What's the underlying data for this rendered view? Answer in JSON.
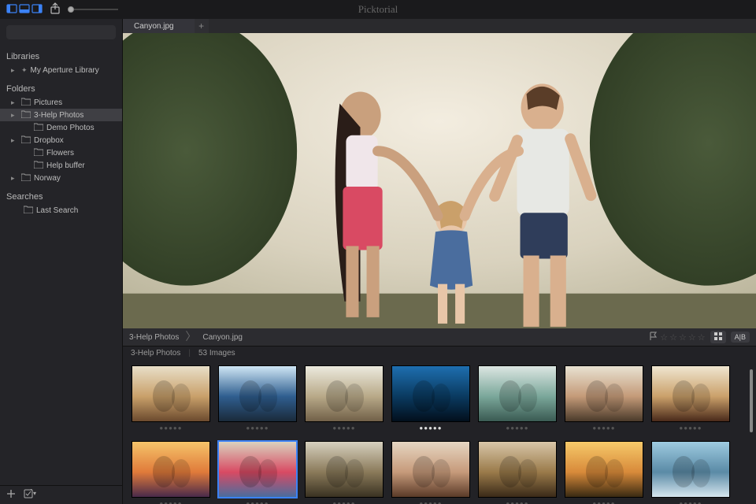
{
  "app_title": "Picktorial",
  "toolbar": {
    "view_icons": [
      "view-layout-left-icon",
      "view-layout-split-icon",
      "view-layout-right-icon"
    ],
    "share_icon": "share-icon"
  },
  "sidebar": {
    "search_placeholder": "",
    "sections": {
      "libraries": {
        "title": "Libraries",
        "items": [
          {
            "label": "My Aperture Library",
            "expandable": true
          }
        ]
      },
      "folders": {
        "title": "Folders",
        "items": [
          {
            "label": "Pictures",
            "expandable": true,
            "indent": 1
          },
          {
            "label": "3-Help Photos",
            "expandable": true,
            "indent": 1,
            "selected": true
          },
          {
            "label": "Demo Photos",
            "expandable": false,
            "indent": 2
          },
          {
            "label": "Dropbox",
            "expandable": true,
            "indent": 1
          },
          {
            "label": "Flowers",
            "expandable": false,
            "indent": 2
          },
          {
            "label": "Help buffer",
            "expandable": false,
            "indent": 2
          },
          {
            "label": "Norway",
            "expandable": true,
            "indent": 1
          }
        ]
      },
      "searches": {
        "title": "Searches",
        "items": [
          {
            "label": "Last Search",
            "expandable": false,
            "indent": 2
          }
        ]
      }
    },
    "footer": {
      "add": "plus-icon",
      "edit": "edit-checkbox-icon"
    }
  },
  "tabs": [
    {
      "label": "Canyon.jpg"
    }
  ],
  "breadcrumb": {
    "folder": "3-Help Photos",
    "file": "Canyon.jpg"
  },
  "info_bar": {
    "flag": "flag-icon",
    "grid_btn": "grid-icon",
    "ab_btn": "A|B",
    "stars": 5
  },
  "filmstrip": {
    "folder": "3-Help Photos",
    "count_label": "53 Images"
  },
  "thumbs": [
    {
      "name": "thumb-1",
      "rated": false,
      "selected": false
    },
    {
      "name": "thumb-2",
      "rated": false,
      "selected": false
    },
    {
      "name": "thumb-3",
      "rated": false,
      "selected": false
    },
    {
      "name": "thumb-4",
      "rated": true,
      "selected": false
    },
    {
      "name": "thumb-5",
      "rated": false,
      "selected": false
    },
    {
      "name": "thumb-6",
      "rated": false,
      "selected": false
    },
    {
      "name": "thumb-7",
      "rated": false,
      "selected": false
    },
    {
      "name": "thumb-8",
      "rated": false,
      "selected": false
    },
    {
      "name": "thumb-9",
      "rated": false,
      "selected": true
    },
    {
      "name": "thumb-10",
      "rated": false,
      "selected": false
    },
    {
      "name": "thumb-11",
      "rated": false,
      "selected": false
    },
    {
      "name": "thumb-12",
      "rated": false,
      "selected": false
    },
    {
      "name": "thumb-13",
      "rated": false,
      "selected": false
    },
    {
      "name": "thumb-14",
      "rated": false,
      "selected": false
    }
  ],
  "rating_dots": "●●●●●"
}
